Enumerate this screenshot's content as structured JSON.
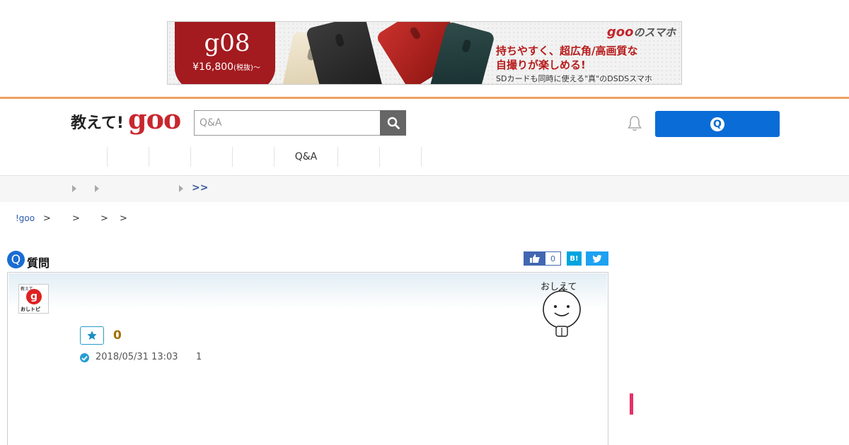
{
  "banner": {
    "model": "g08",
    "price": "¥16,800",
    "price_note": "(税抜)〜",
    "brand_goo": "goo",
    "brand_suffix": "のスマホ",
    "line1": "持ちやすく、超広角/高画質な",
    "line2": "自撮りが楽しめる!",
    "line3": "SDカードも同時に使える\"真\"のDSDSスマホ"
  },
  "header": {
    "logo_text": "教えて!",
    "logo_goo": "goo",
    "search_placeholder": "Q&A",
    "ask_button_icon": "Q"
  },
  "nav": {
    "items": [
      "",
      "",
      "",
      "",
      "Q&A",
      "",
      ""
    ]
  },
  "categories": {
    "more": ">>"
  },
  "breadcrumb": {
    "items": [
      "!goo",
      ">",
      ">",
      ">",
      ">"
    ]
  },
  "question": {
    "section_icon": "Q",
    "section_label": "質問",
    "like_count": "0",
    "hatena_label": "B!",
    "favorite_count": "0",
    "date": "2018/05/31 13:03",
    "answer_count": "1"
  },
  "avatar": {
    "line1": "教えて",
    "letter": "g",
    "line2": "おしトピ"
  },
  "colors": {
    "accent_rule": "#f0a060",
    "ask_button": "#0a6cd6",
    "logo_red": "#c8272f",
    "question_blue": "#1a6cd2"
  }
}
